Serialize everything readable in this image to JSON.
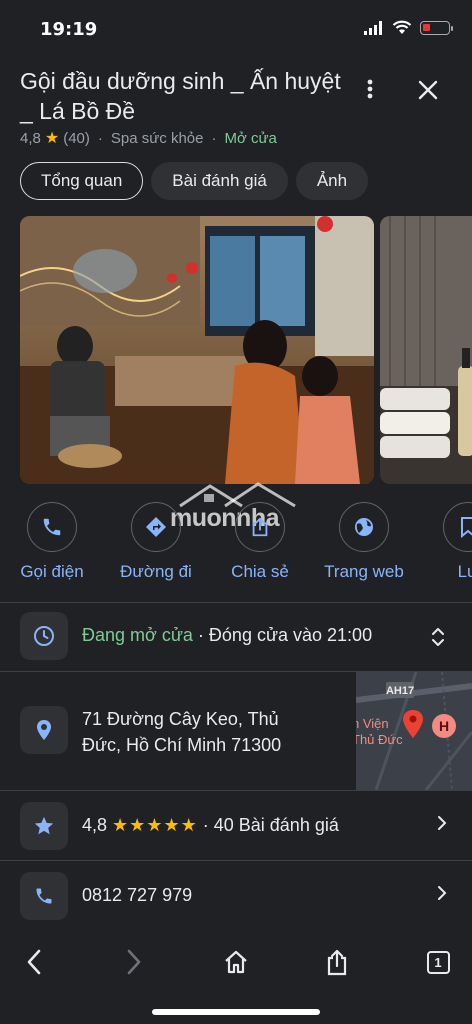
{
  "status": {
    "time": "19:19"
  },
  "place": {
    "title": "Gội đầu dưỡng sinh _ Ấn huyệt _ Lá Bồ Đề",
    "rating": "4,8",
    "reviews_count": "(40)",
    "category": "Spa sức khỏe",
    "open_status": "Mở cửa"
  },
  "tabs": [
    {
      "label": "Tổng quan"
    },
    {
      "label": "Bài đánh giá"
    },
    {
      "label": "Ảnh"
    }
  ],
  "watermark": "muonnha",
  "actions": [
    {
      "label": "Gọi điện",
      "icon": "phone-icon"
    },
    {
      "label": "Đường đi",
      "icon": "directions-icon"
    },
    {
      "label": "Chia sẻ",
      "icon": "share-icon"
    },
    {
      "label": "Trang web",
      "icon": "globe-icon"
    },
    {
      "label": "Lư",
      "icon": "bookmark-icon"
    }
  ],
  "hours": {
    "open_text": "Đang mở cửa",
    "close_text": "· Đóng cửa vào 21:00"
  },
  "address": {
    "line1": "71 Đường Cây Keo, Thủ",
    "line2": "Đức, Hồ Chí Minh 71300"
  },
  "map": {
    "road_label": "AH17",
    "label1": "h Viện",
    "label2": "Thủ Đức"
  },
  "reviews": {
    "rating": "4,8",
    "stars": "★★★★★",
    "text": "· 40 Bài đánh giá"
  },
  "phone": {
    "number": "0812 727 979"
  },
  "browser": {
    "tab_count": "1"
  },
  "colors": {
    "accent": "#8ab4f8",
    "open_green": "#81c995",
    "star": "#fbbc04",
    "background": "#202124"
  }
}
